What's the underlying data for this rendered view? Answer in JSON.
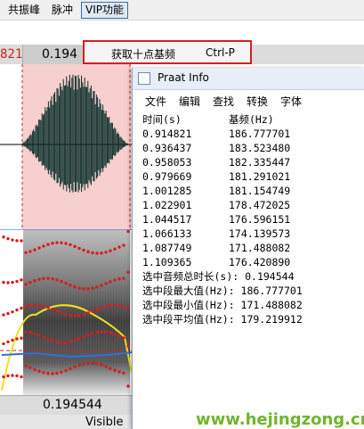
{
  "menubar": {
    "items": [
      "共振峰",
      "脉冲"
    ],
    "vip_label": "VIP功能"
  },
  "dropdown": {
    "item_label": "获取十点基频",
    "shortcut": "Ctrl-P"
  },
  "editor": {
    "time_left": "821",
    "time_selection": "0.194",
    "bottom_duration": "0.194544",
    "visible_label": "Visible"
  },
  "info_window": {
    "title": "Praat Info",
    "menu": [
      "文件",
      "编辑",
      "查找",
      "转换",
      "字体"
    ],
    "header": {
      "col1": "时间(s)",
      "col2": "基频(Hz)"
    },
    "rows": [
      {
        "time": "0.914821",
        "f0": "186.777701"
      },
      {
        "time": "0.936437",
        "f0": "183.523480"
      },
      {
        "time": "0.958053",
        "f0": "182.335447"
      },
      {
        "time": "0.979669",
        "f0": "181.291021"
      },
      {
        "time": "1.001285",
        "f0": "181.154749"
      },
      {
        "time": "1.022901",
        "f0": "178.472025"
      },
      {
        "time": "1.044517",
        "f0": "176.596151"
      },
      {
        "time": "1.066133",
        "f0": "174.139573"
      },
      {
        "time": "1.087749",
        "f0": "171.488082"
      },
      {
        "time": "1.109365",
        "f0": "176.420890"
      }
    ],
    "summary": [
      "选中音频总时长(s): 0.194544",
      "选中段最大值(Hz): 186.777701",
      "选中段最小值(Hz): 171.488082",
      "选中段平均值(Hz): 179.219912"
    ]
  },
  "watermark": "www.hejingzong.cn"
}
